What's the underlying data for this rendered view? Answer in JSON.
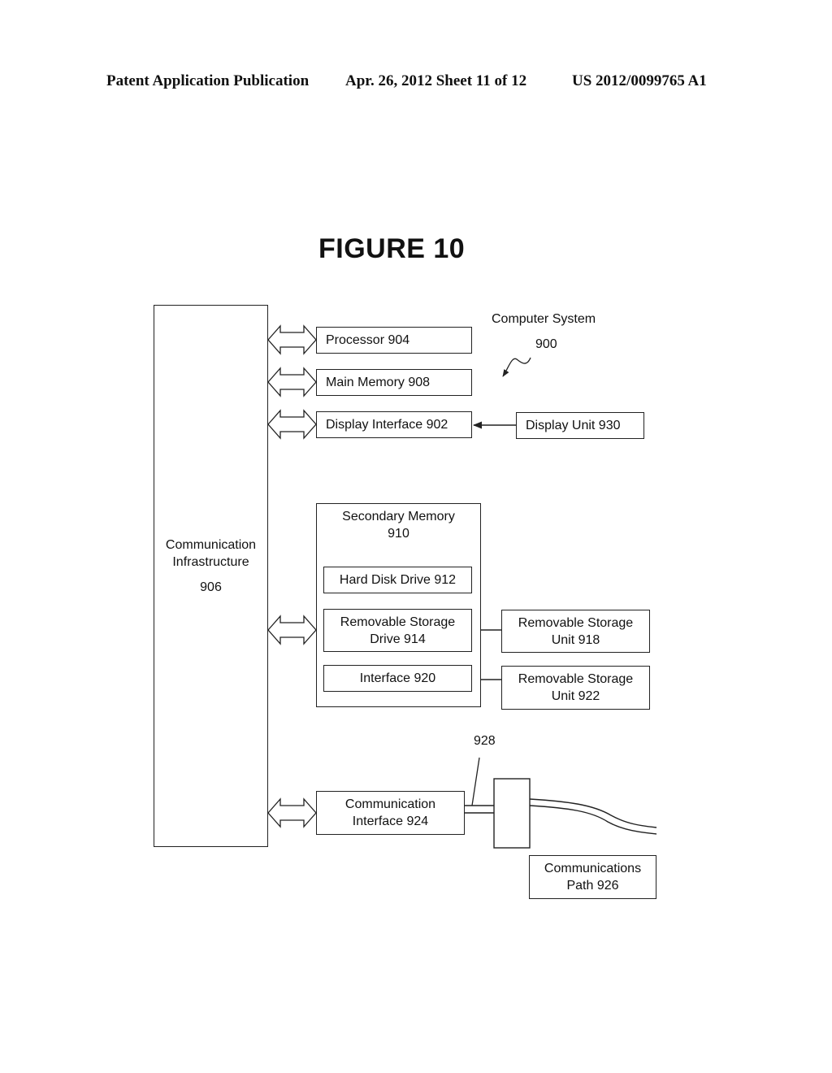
{
  "header": {
    "publication": "Patent Application Publication",
    "date_sheet": "Apr. 26, 2012  Sheet 11 of 12",
    "patent_number": "US 2012/0099765 A1"
  },
  "figure": {
    "title": "FIGURE 10",
    "system_label": "Computer System",
    "system_number": "900",
    "comm_infra": {
      "line1": "Communication",
      "line2": "Infrastructure",
      "number": "906"
    },
    "processor": "Processor 904",
    "main_memory": "Main Memory 908",
    "display_interface": "Display Interface 902",
    "display_unit": "Display Unit 930",
    "secondary_memory": {
      "line1": "Secondary Memory",
      "line2": "910"
    },
    "hard_disk": "Hard Disk Drive 912",
    "removable_drive": {
      "line1": "Removable Storage",
      "line2": "Drive 914"
    },
    "interface": "Interface 920",
    "removable_unit_918": {
      "line1": "Removable Storage",
      "line2": "Unit 918"
    },
    "removable_unit_922": {
      "line1": "Removable Storage",
      "line2": "Unit 922"
    },
    "comm_interface": {
      "line1": "Communication",
      "line2": "Interface 924"
    },
    "channel_label": "928",
    "comm_path": {
      "line1": "Communications",
      "line2": "Path 926"
    }
  }
}
